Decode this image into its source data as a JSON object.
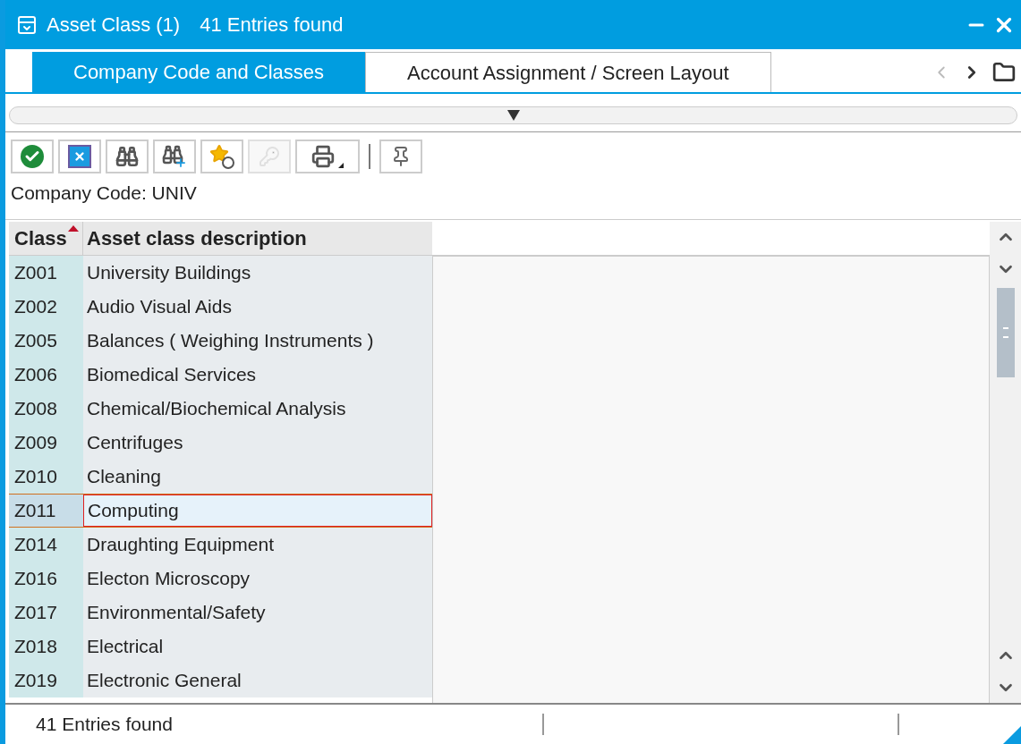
{
  "window": {
    "title": "Asset Class (1)",
    "subtitle": "41 Entries found"
  },
  "tabs": [
    {
      "label": "Company Code and Classes",
      "selected": true
    },
    {
      "label": "Account Assignment / Screen Layout",
      "selected": false
    }
  ],
  "toolbar": [
    {
      "kind": "check",
      "disabled": false
    },
    {
      "kind": "cancel",
      "disabled": false
    },
    {
      "kind": "find",
      "disabled": false
    },
    {
      "kind": "find-next",
      "disabled": false
    },
    {
      "kind": "favorite",
      "disabled": false
    },
    {
      "kind": "key",
      "disabled": true
    },
    {
      "kind": "print",
      "disabled": false
    },
    {
      "kind": "separator"
    },
    {
      "kind": "pin",
      "disabled": false
    }
  ],
  "company_code": "Company Code: UNIV",
  "table": {
    "columns": [
      "Class",
      "Asset class description"
    ],
    "rows": [
      {
        "class": "Z001",
        "description": "University Buildings",
        "selected": false
      },
      {
        "class": "Z002",
        "description": "Audio Visual Aids",
        "selected": false
      },
      {
        "class": "Z005",
        "description": "Balances ( Weighing Instruments )",
        "selected": false
      },
      {
        "class": "Z006",
        "description": "Biomedical Services",
        "selected": false
      },
      {
        "class": "Z008",
        "description": "Chemical/Biochemical Analysis",
        "selected": false
      },
      {
        "class": "Z009",
        "description": "Centrifuges",
        "selected": false
      },
      {
        "class": "Z010",
        "description": "Cleaning",
        "selected": false
      },
      {
        "class": "Z011",
        "description": "Computing",
        "selected": true
      },
      {
        "class": "Z014",
        "description": "Draughting Equipment",
        "selected": false
      },
      {
        "class": "Z016",
        "description": "Electon Microscopy",
        "selected": false
      },
      {
        "class": "Z017",
        "description": "Environmental/Safety",
        "selected": false
      },
      {
        "class": "Z018",
        "description": "Electrical",
        "selected": false
      },
      {
        "class": "Z019",
        "description": "Electronic General",
        "selected": false
      }
    ]
  },
  "status_bar": {
    "message": "41 Entries found"
  }
}
